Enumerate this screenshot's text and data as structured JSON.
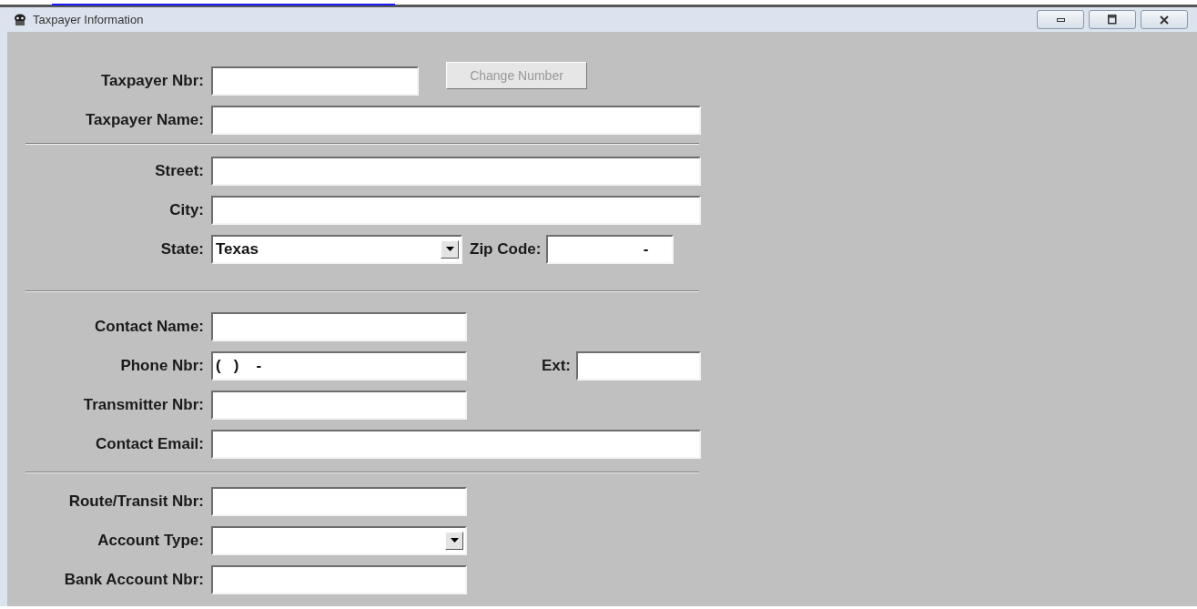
{
  "window": {
    "title": "Taxpayer Information",
    "controls": [
      {
        "kind": "minimize"
      },
      {
        "kind": "maximize"
      },
      {
        "kind": "close"
      }
    ]
  },
  "sections": [
    {
      "rows": [
        {
          "label": "Taxpayer Nbr:",
          "field": {
            "kind": "text"
          },
          "button": {
            "label": "Change Number",
            "disabled": true
          }
        },
        {
          "label": "Taxpayer Name:",
          "field": {
            "kind": "text"
          }
        }
      ]
    },
    {
      "rows": [
        {
          "label": "Street:",
          "field": {
            "kind": "text"
          }
        },
        {
          "label": "City:",
          "field": {
            "kind": "text"
          }
        },
        {
          "label": "State:",
          "field": {
            "kind": "select",
            "value": "Texas"
          },
          "extra": {
            "label": "Zip Code:",
            "field": {
              "kind": "text",
              "value": "-"
            }
          }
        }
      ]
    },
    {
      "rows": [
        {
          "label": "Contact Name:",
          "field": {
            "kind": "text"
          }
        },
        {
          "label": "Phone Nbr:",
          "field": {
            "kind": "text",
            "value": "(   )    -"
          },
          "extra": {
            "label": "Ext:",
            "field": {
              "kind": "text"
            }
          }
        },
        {
          "label": "Transmitter Nbr:",
          "field": {
            "kind": "text"
          }
        },
        {
          "label": "Contact Email:",
          "field": {
            "kind": "text"
          }
        }
      ]
    },
    {
      "rows": [
        {
          "label": "Route/Transit Nbr:",
          "field": {
            "kind": "text"
          }
        },
        {
          "label": "Account Type:",
          "field": {
            "kind": "select"
          }
        },
        {
          "label": "Bank Account Nbr:",
          "field": {
            "kind": "text"
          }
        }
      ]
    }
  ]
}
